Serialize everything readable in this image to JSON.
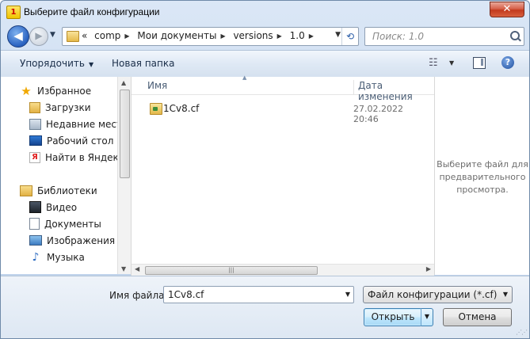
{
  "window": {
    "title": "Выберите файл конфигурации",
    "close_label": "✕"
  },
  "navigation": {
    "back_glyph": "◀",
    "forward_glyph": "▶",
    "recent_glyph": "▼",
    "breadcrumbs": [
      "«",
      "comp",
      "Мои документы",
      "versions",
      "1.0"
    ],
    "search_placeholder": "Поиск: 1.0"
  },
  "toolbar": {
    "organize_label": "Упорядочить",
    "new_folder_label": "Новая папка",
    "help_label": "?"
  },
  "sidebar": {
    "favorites": [
      {
        "label": "Избранное",
        "icon": "star-icon",
        "header": true
      },
      {
        "label": "Загрузки",
        "icon": "downloads-folder-icon"
      },
      {
        "label": "Недавние места",
        "icon": "recent-places-icon"
      },
      {
        "label": "Рабочий стол",
        "icon": "desktop-icon"
      },
      {
        "label": "Найти в Яндексе",
        "icon": "yandex-icon"
      }
    ],
    "libraries": [
      {
        "label": "Библиотеки",
        "icon": "libraries-icon",
        "header": true
      },
      {
        "label": "Видео",
        "icon": "video-icon"
      },
      {
        "label": "Документы",
        "icon": "documents-icon"
      },
      {
        "label": "Изображения",
        "icon": "images-icon"
      },
      {
        "label": "Музыка",
        "icon": "music-icon"
      }
    ]
  },
  "file_list": {
    "columns": {
      "name": "Имя",
      "date": "Дата изменения"
    },
    "rows": [
      {
        "name": "1Cv8.cf",
        "date": "27.02.2022 20:46"
      }
    ]
  },
  "preview": {
    "message": "Выберите файл для предварительного просмотра."
  },
  "bottom": {
    "filename_label": "Имя файла:",
    "filename_value": "1Cv8.cf",
    "filter_value": "Файл конфигурации (*.cf)",
    "open_label": "Открыть",
    "cancel_label": "Отмена"
  },
  "colors": {
    "accent": "#2a62c0",
    "frame": "#c3d6ee",
    "close": "#c23a1d"
  }
}
